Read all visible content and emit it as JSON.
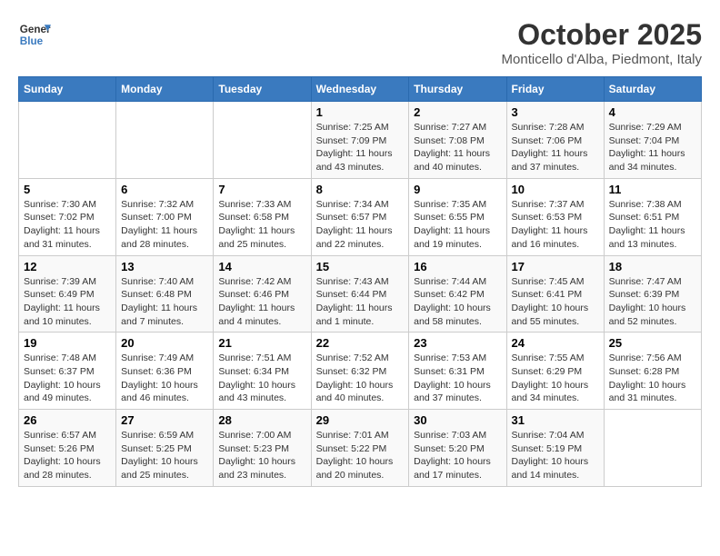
{
  "header": {
    "logo_line1": "General",
    "logo_line2": "Blue",
    "month": "October 2025",
    "location": "Monticello d'Alba, Piedmont, Italy"
  },
  "days_of_week": [
    "Sunday",
    "Monday",
    "Tuesday",
    "Wednesday",
    "Thursday",
    "Friday",
    "Saturday"
  ],
  "weeks": [
    [
      {
        "day": "",
        "info": ""
      },
      {
        "day": "",
        "info": ""
      },
      {
        "day": "",
        "info": ""
      },
      {
        "day": "1",
        "info": "Sunrise: 7:25 AM\nSunset: 7:09 PM\nDaylight: 11 hours\nand 43 minutes."
      },
      {
        "day": "2",
        "info": "Sunrise: 7:27 AM\nSunset: 7:08 PM\nDaylight: 11 hours\nand 40 minutes."
      },
      {
        "day": "3",
        "info": "Sunrise: 7:28 AM\nSunset: 7:06 PM\nDaylight: 11 hours\nand 37 minutes."
      },
      {
        "day": "4",
        "info": "Sunrise: 7:29 AM\nSunset: 7:04 PM\nDaylight: 11 hours\nand 34 minutes."
      }
    ],
    [
      {
        "day": "5",
        "info": "Sunrise: 7:30 AM\nSunset: 7:02 PM\nDaylight: 11 hours\nand 31 minutes."
      },
      {
        "day": "6",
        "info": "Sunrise: 7:32 AM\nSunset: 7:00 PM\nDaylight: 11 hours\nand 28 minutes."
      },
      {
        "day": "7",
        "info": "Sunrise: 7:33 AM\nSunset: 6:58 PM\nDaylight: 11 hours\nand 25 minutes."
      },
      {
        "day": "8",
        "info": "Sunrise: 7:34 AM\nSunset: 6:57 PM\nDaylight: 11 hours\nand 22 minutes."
      },
      {
        "day": "9",
        "info": "Sunrise: 7:35 AM\nSunset: 6:55 PM\nDaylight: 11 hours\nand 19 minutes."
      },
      {
        "day": "10",
        "info": "Sunrise: 7:37 AM\nSunset: 6:53 PM\nDaylight: 11 hours\nand 16 minutes."
      },
      {
        "day": "11",
        "info": "Sunrise: 7:38 AM\nSunset: 6:51 PM\nDaylight: 11 hours\nand 13 minutes."
      }
    ],
    [
      {
        "day": "12",
        "info": "Sunrise: 7:39 AM\nSunset: 6:49 PM\nDaylight: 11 hours\nand 10 minutes."
      },
      {
        "day": "13",
        "info": "Sunrise: 7:40 AM\nSunset: 6:48 PM\nDaylight: 11 hours\nand 7 minutes."
      },
      {
        "day": "14",
        "info": "Sunrise: 7:42 AM\nSunset: 6:46 PM\nDaylight: 11 hours\nand 4 minutes."
      },
      {
        "day": "15",
        "info": "Sunrise: 7:43 AM\nSunset: 6:44 PM\nDaylight: 11 hours\nand 1 minute."
      },
      {
        "day": "16",
        "info": "Sunrise: 7:44 AM\nSunset: 6:42 PM\nDaylight: 10 hours\nand 58 minutes."
      },
      {
        "day": "17",
        "info": "Sunrise: 7:45 AM\nSunset: 6:41 PM\nDaylight: 10 hours\nand 55 minutes."
      },
      {
        "day": "18",
        "info": "Sunrise: 7:47 AM\nSunset: 6:39 PM\nDaylight: 10 hours\nand 52 minutes."
      }
    ],
    [
      {
        "day": "19",
        "info": "Sunrise: 7:48 AM\nSunset: 6:37 PM\nDaylight: 10 hours\nand 49 minutes."
      },
      {
        "day": "20",
        "info": "Sunrise: 7:49 AM\nSunset: 6:36 PM\nDaylight: 10 hours\nand 46 minutes."
      },
      {
        "day": "21",
        "info": "Sunrise: 7:51 AM\nSunset: 6:34 PM\nDaylight: 10 hours\nand 43 minutes."
      },
      {
        "day": "22",
        "info": "Sunrise: 7:52 AM\nSunset: 6:32 PM\nDaylight: 10 hours\nand 40 minutes."
      },
      {
        "day": "23",
        "info": "Sunrise: 7:53 AM\nSunset: 6:31 PM\nDaylight: 10 hours\nand 37 minutes."
      },
      {
        "day": "24",
        "info": "Sunrise: 7:55 AM\nSunset: 6:29 PM\nDaylight: 10 hours\nand 34 minutes."
      },
      {
        "day": "25",
        "info": "Sunrise: 7:56 AM\nSunset: 6:28 PM\nDaylight: 10 hours\nand 31 minutes."
      }
    ],
    [
      {
        "day": "26",
        "info": "Sunrise: 6:57 AM\nSunset: 5:26 PM\nDaylight: 10 hours\nand 28 minutes."
      },
      {
        "day": "27",
        "info": "Sunrise: 6:59 AM\nSunset: 5:25 PM\nDaylight: 10 hours\nand 25 minutes."
      },
      {
        "day": "28",
        "info": "Sunrise: 7:00 AM\nSunset: 5:23 PM\nDaylight: 10 hours\nand 23 minutes."
      },
      {
        "day": "29",
        "info": "Sunrise: 7:01 AM\nSunset: 5:22 PM\nDaylight: 10 hours\nand 20 minutes."
      },
      {
        "day": "30",
        "info": "Sunrise: 7:03 AM\nSunset: 5:20 PM\nDaylight: 10 hours\nand 17 minutes."
      },
      {
        "day": "31",
        "info": "Sunrise: 7:04 AM\nSunset: 5:19 PM\nDaylight: 10 hours\nand 14 minutes."
      },
      {
        "day": "",
        "info": ""
      }
    ]
  ]
}
